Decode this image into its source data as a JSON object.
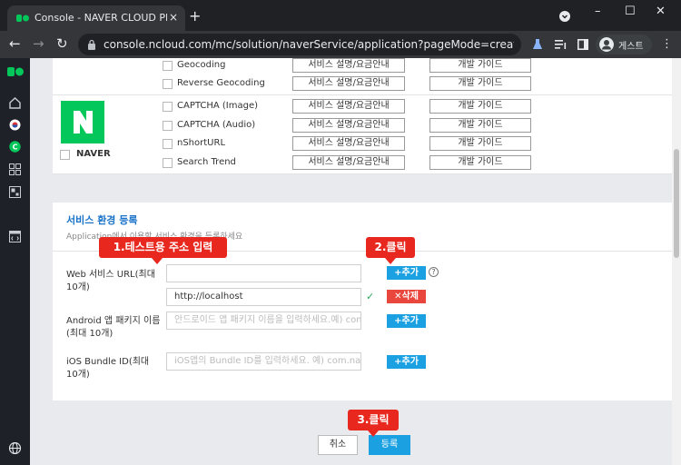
{
  "browser": {
    "tab_title": "Console - NAVER CLOUD PLATF",
    "tab_close": "×",
    "new_tab": "+",
    "url": "console.ncloud.com/mc/solution/naverService/application?pageMode=create&version...",
    "profile_name": "게스트",
    "window_minimize": "–",
    "window_maximize": "☐",
    "window_close": "✕"
  },
  "api_list": [
    {
      "name": "Geocoding",
      "service_label": "서비스 설명/요금안내",
      "guide_label": "개발 가이드"
    },
    {
      "name": "Reverse Geocoding",
      "service_label": "서비스 설명/요금안내",
      "guide_label": "개발 가이드"
    },
    {
      "name": "CAPTCHA (Image)",
      "service_label": "서비스 설명/요금안내",
      "guide_label": "개발 가이드"
    },
    {
      "name": "CAPTCHA (Audio)",
      "service_label": "서비스 설명/요금안내",
      "guide_label": "개발 가이드"
    },
    {
      "name": "nShortURL",
      "service_label": "서비스 설명/요금안내",
      "guide_label": "개발 가이드"
    },
    {
      "name": "Search Trend",
      "service_label": "서비스 설명/요금안내",
      "guide_label": "개발 가이드"
    }
  ],
  "naver_group": {
    "logo_letter": "N",
    "label": "NAVER"
  },
  "service_env": {
    "title": "서비스 환경 등록",
    "description": "Application에서 이용할 서비스 환경을 등록하세요",
    "web_label": "Web 서비스 URL(최대 10개)",
    "web_input_value": "",
    "web_registered_url": "http://localhost",
    "android_label": "Android 앱 패키지 이름 (최대 10개)",
    "android_placeholder": "안드로이드 앱 패키지 이름을 입력하세요.예) com.nave",
    "ios_label": "iOS Bundle ID(최대 10개)",
    "ios_placeholder": "iOS앱의 Bundle ID를 입력하세요. 예) com.nave",
    "add_label": "+추가",
    "delete_label": "✕삭제",
    "help_label": "?",
    "check_mark": "✓"
  },
  "footer": {
    "cancel_label": "취소",
    "submit_label": "등록"
  },
  "callouts": {
    "step1": "1.테스트용 주소 입력",
    "step2": "2.클릭",
    "step3": "3.클릭"
  },
  "colors": {
    "accent": "#1ba1e2",
    "danger": "#e9473d",
    "callout": "#e8281f",
    "naver_green": "#03c75a",
    "section_title": "#1a73c8"
  }
}
